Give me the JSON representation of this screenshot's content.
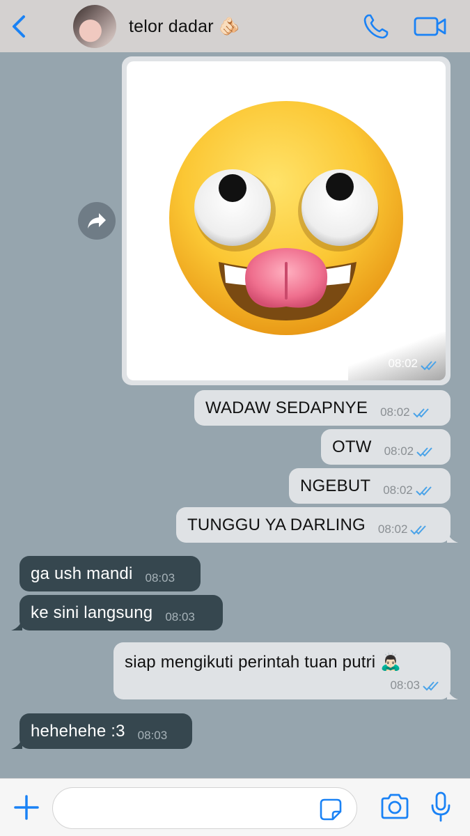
{
  "header": {
    "contact_name": "telor dadar 🫵🏻",
    "colors": {
      "accent": "#1a82f5",
      "header_bg": "#d4d1d0"
    }
  },
  "messages": [
    {
      "type": "image",
      "direction": "outgoing",
      "content": "eye-roll-tongue-emoji-sticker",
      "time": "08:02",
      "status": "read"
    },
    {
      "direction": "outgoing",
      "text": "WADAW SEDAPNYE",
      "time": "08:02",
      "status": "read"
    },
    {
      "direction": "outgoing",
      "text": "OTW",
      "time": "08:02",
      "status": "read"
    },
    {
      "direction": "outgoing",
      "text": "NGEBUT",
      "time": "08:02",
      "status": "read"
    },
    {
      "direction": "outgoing",
      "text": "TUNGGU YA DARLING",
      "time": "08:02",
      "status": "read"
    },
    {
      "direction": "incoming",
      "text": "ga ush mandi",
      "time": "08:03"
    },
    {
      "direction": "incoming",
      "text": "ke sini langsung",
      "time": "08:03"
    },
    {
      "direction": "outgoing",
      "text": "siap mengikuti perintah tuan putri 🙇🏻‍♂️",
      "time": "08:03",
      "status": "read"
    },
    {
      "direction": "incoming",
      "text": "hehehehe :3",
      "time": "08:03"
    }
  ],
  "composer": {
    "value": "",
    "placeholder": ""
  },
  "icons": {
    "back": "chevron-left-icon",
    "call": "phone-icon",
    "video": "video-camera-icon",
    "forward": "forward-arrow-icon",
    "plus": "plus-icon",
    "sticker": "sticker-icon",
    "camera": "camera-icon",
    "mic": "microphone-icon"
  },
  "colors": {
    "chat_bg": "#96a5ae",
    "outgoing_bubble": "#dfe2e5",
    "incoming_bubble": "#36474f",
    "read_ticks": "#4aa3e8"
  }
}
